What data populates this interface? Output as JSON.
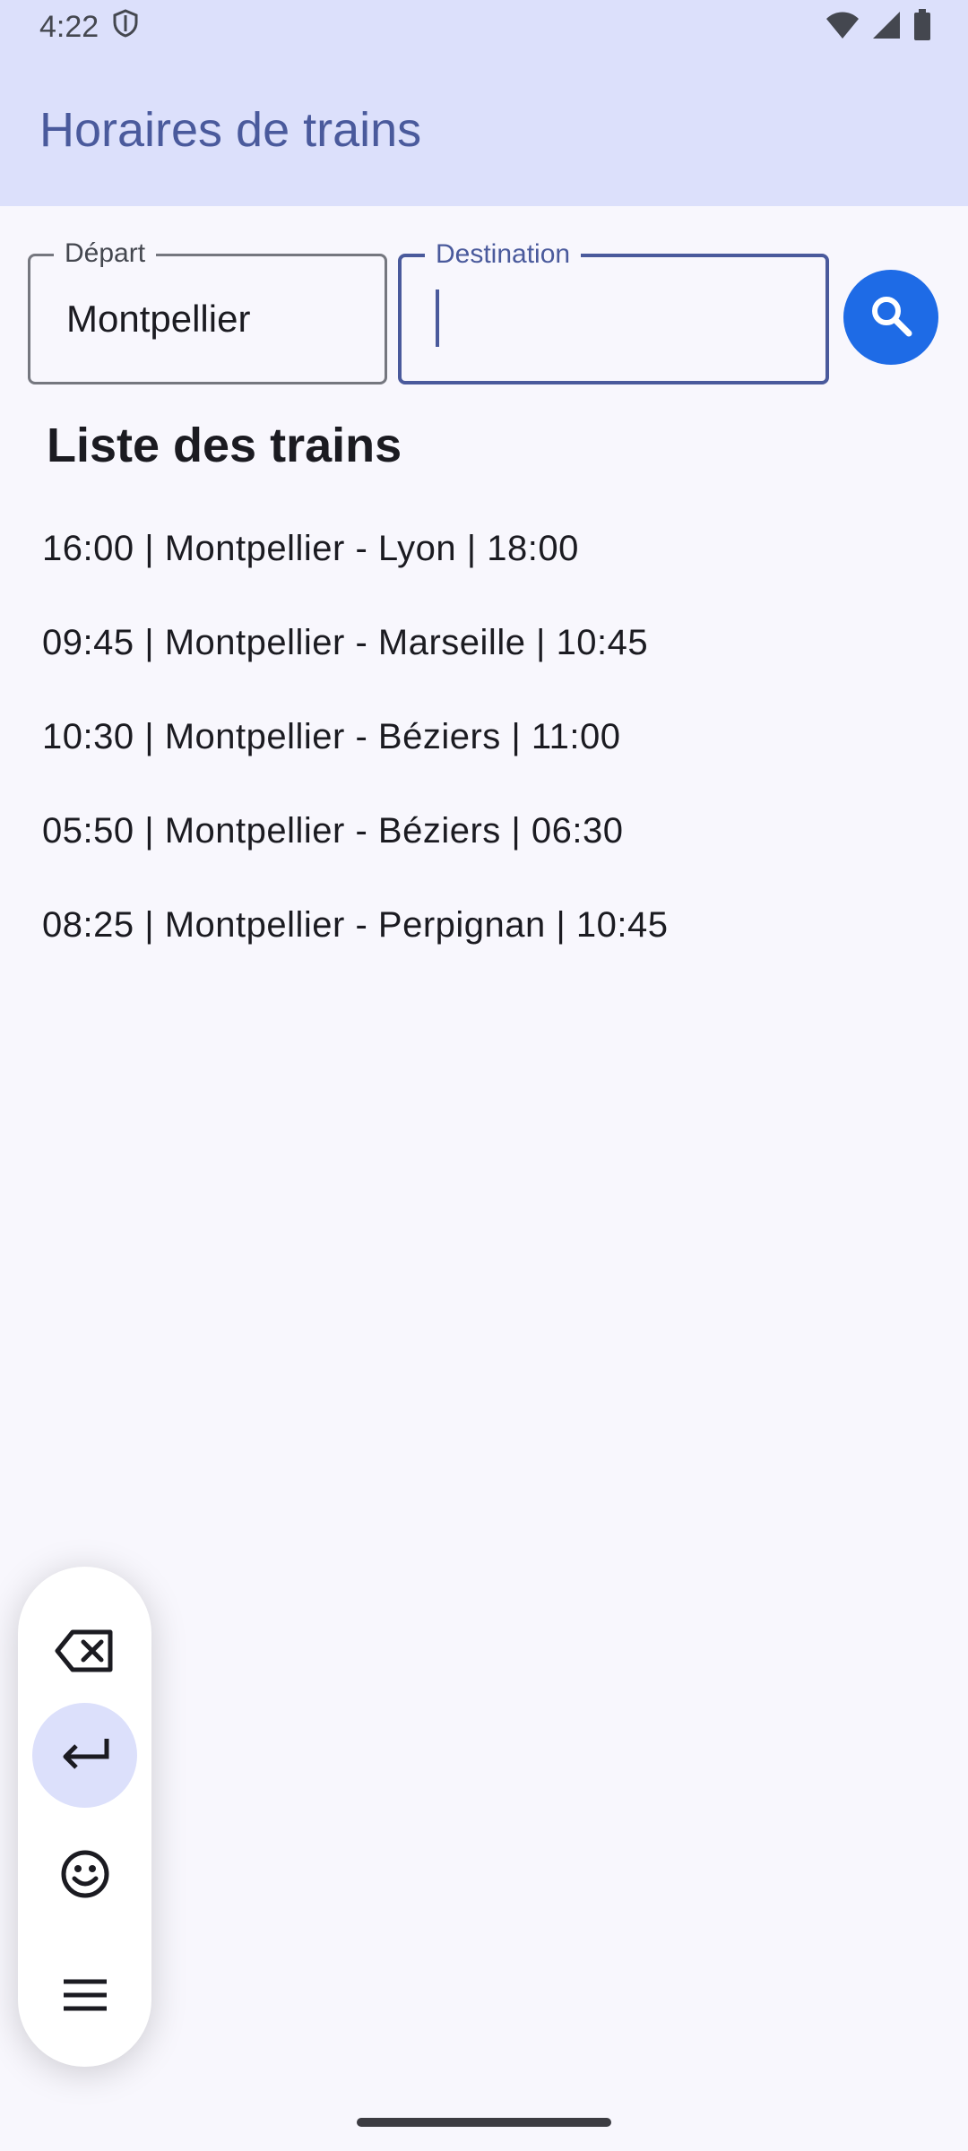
{
  "status": {
    "time": "4:22"
  },
  "app": {
    "title": "Horaires de trains"
  },
  "form": {
    "depart_label": "Départ",
    "depart_value": "Montpellier",
    "destination_label": "Destination",
    "destination_value": ""
  },
  "list": {
    "title": "Liste des trains",
    "items": [
      "16:00 | Montpellier - Lyon | 18:00",
      "09:45 | Montpellier - Marseille | 10:45",
      "10:30 | Montpellier - Béziers | 11:00",
      "05:50 | Montpellier - Béziers | 06:30",
      "08:25 | Montpellier - Perpignan | 10:45"
    ]
  },
  "keyboard_toolbar": {
    "buttons": [
      "backspace-icon",
      "enter-icon",
      "emoji-icon",
      "menu-icon"
    ],
    "active": "enter-icon"
  },
  "colors": {
    "primary": "#4a5a9c",
    "app_bar": "#dce0fb",
    "search_button": "#1e6be6",
    "background": "#f8f7fd"
  }
}
